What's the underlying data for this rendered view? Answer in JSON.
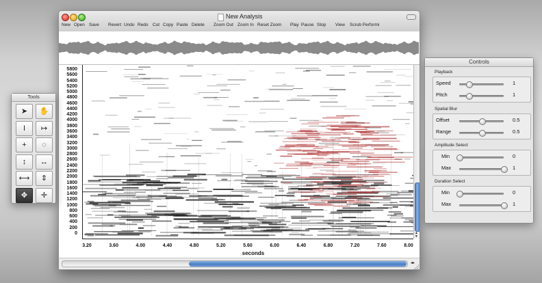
{
  "window": {
    "title": "New Analysis",
    "toolbar": [
      "New",
      "Open",
      "Save",
      "Revert",
      "Undo",
      "Redo",
      "Cut",
      "Copy",
      "Paste",
      "Delete",
      "Zoom Out",
      "Zoom In",
      "Reset Zoom",
      "Play",
      "Pause",
      "Stop",
      "View",
      "Scrub Performi"
    ]
  },
  "spectrogram": {
    "y_ticks": [
      "5800",
      "5600",
      "5400",
      "5200",
      "5000",
      "4800",
      "4600",
      "4400",
      "4200",
      "4000",
      "3800",
      "3600",
      "3400",
      "3200",
      "3000",
      "2800",
      "2600",
      "2400",
      "2200",
      "2000",
      "1800",
      "1600",
      "1400",
      "1200",
      "1000",
      "800",
      "600",
      "400",
      "200",
      "0"
    ],
    "x_ticks": [
      "3.20",
      "3.60",
      "4.00",
      "4.40",
      "4.80",
      "5.20",
      "5.60",
      "6.00",
      "6.40",
      "6.80",
      "7.20",
      "7.60",
      "8.00"
    ],
    "x_label": "seconds",
    "highlight_color": "#b33a3a"
  },
  "tools": {
    "title": "Tools",
    "items": [
      {
        "name": "pointer-tool",
        "glyph": "➤",
        "active": false
      },
      {
        "name": "hand-tool",
        "glyph": "✋",
        "active": false
      },
      {
        "name": "text-cursor-tool",
        "glyph": "I",
        "active": false
      },
      {
        "name": "time-select-tool",
        "glyph": "↦",
        "active": false
      },
      {
        "name": "crosshair-tool",
        "glyph": "+",
        "active": false
      },
      {
        "name": "lasso-tool",
        "glyph": "◌",
        "active": false
      },
      {
        "name": "vertical-zoom-tool",
        "glyph": "↕",
        "active": false
      },
      {
        "name": "horizontal-zoom-tool",
        "glyph": "↔",
        "active": false
      },
      {
        "name": "horizontal-move-tool",
        "glyph": "⟷",
        "active": false
      },
      {
        "name": "vertical-move-tool",
        "glyph": "⇕",
        "active": false
      },
      {
        "name": "move-all-tool",
        "glyph": "✥",
        "active": true
      },
      {
        "name": "scrub-tool",
        "glyph": "✛",
        "active": false
      }
    ]
  },
  "controls": {
    "title": "Controls",
    "groups": [
      {
        "label": "Playback",
        "rows": [
          {
            "label": "Speed",
            "value": "1",
            "fraction": 0.22
          },
          {
            "label": "Pitch",
            "value": "1",
            "fraction": 0.22
          }
        ]
      },
      {
        "label": "Spatial Blur",
        "rows": [
          {
            "label": "Offset",
            "value": "0.5",
            "fraction": 0.5
          },
          {
            "label": "Range",
            "value": "0.5",
            "fraction": 0.5
          }
        ]
      },
      {
        "label": "Amplitude Select",
        "rows": [
          {
            "label": "Min",
            "value": "0",
            "fraction": 0.0
          },
          {
            "label": "Max",
            "value": "1",
            "fraction": 1.0
          }
        ]
      },
      {
        "label": "Duration Select",
        "rows": [
          {
            "label": "Min",
            "value": "0",
            "fraction": 0.0
          },
          {
            "label": "Max",
            "value": "1",
            "fraction": 1.0
          }
        ]
      }
    ]
  }
}
